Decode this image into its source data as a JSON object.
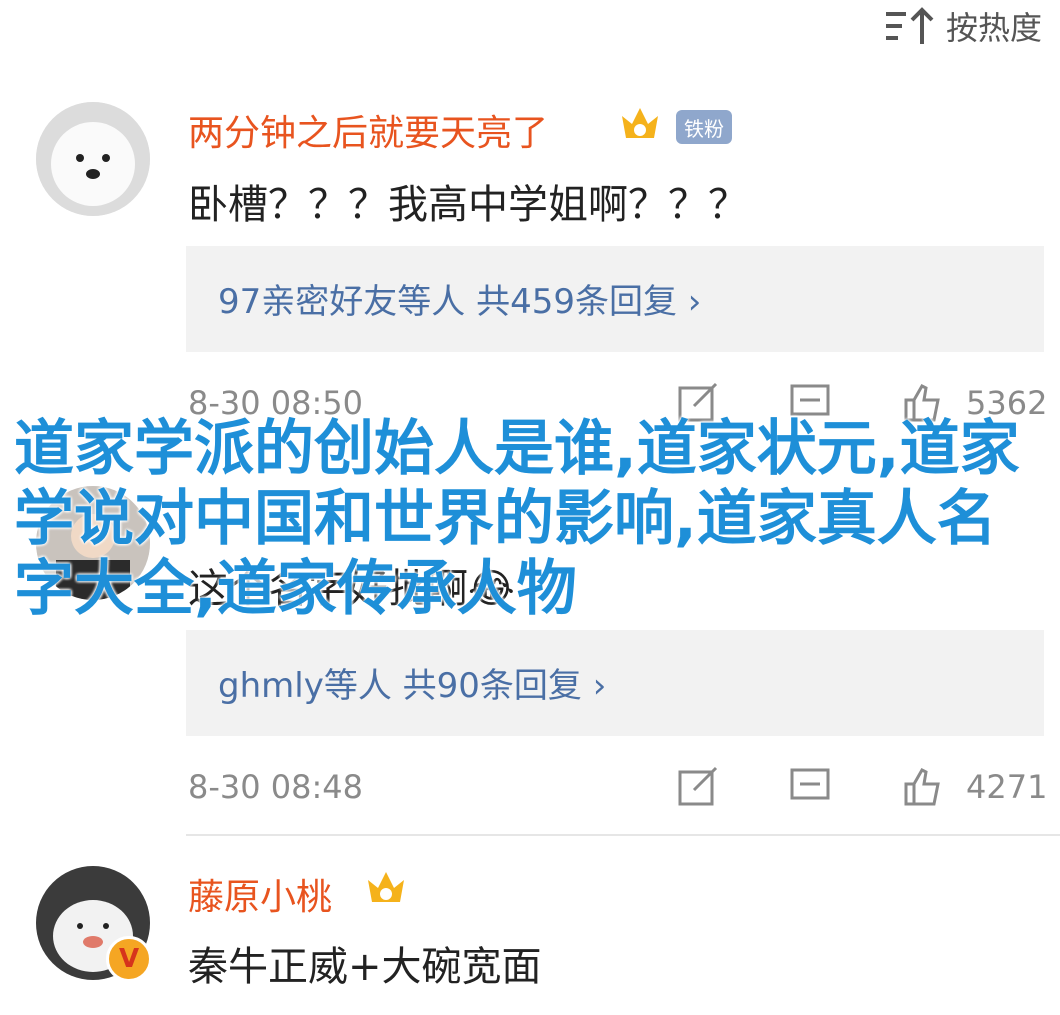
{
  "sort": {
    "label": "按热度",
    "icon": "sort-icon"
  },
  "comments": [
    {
      "username": "两分钟之后就要天亮了",
      "fan_badge": "铁粉",
      "content": "卧槽？？？我高中学姐啊？？？",
      "reply_summary": "97亲密好友等人 共459条回复 ›",
      "time": "8-30 08:50",
      "likes": "5362"
    },
    {
      "username": "",
      "content": "这个名字好批啊😂",
      "reply_summary": "ghmly等人 共90条回复 ›",
      "time": "8-30 08:48",
      "likes": "4271"
    },
    {
      "username": "藤原小桃",
      "content": "秦牛正威+大碗宽面",
      "verified": "V"
    }
  ],
  "overlay": {
    "title": "道家学派的创始人是谁,道家状元,道家学说对中国和世界的影响,道家真人名字大全,道家传承人物"
  },
  "colors": {
    "username": "#e8541f",
    "reply_link": "#4a6fa5",
    "overlay_title": "#1e8fd8",
    "meta_gray": "#8a8a8a"
  }
}
